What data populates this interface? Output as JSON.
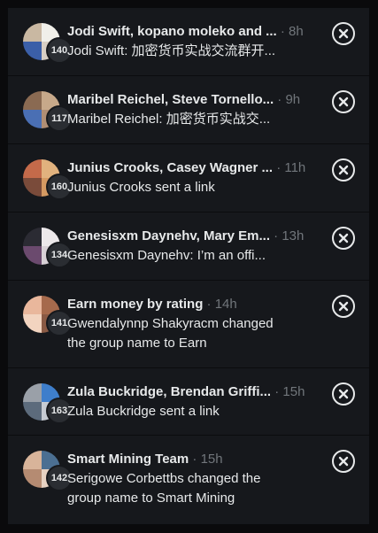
{
  "conversations": [
    {
      "title": "Jodi Swift, kopano moleko and ...",
      "time": "8h",
      "count": "140",
      "preview": "Jodi Swift: 加密货币实战交流群开...",
      "avatar_colors": [
        "#c9b8a2",
        "#f0efe9",
        "#3b5fa8",
        "#d8cfc4"
      ]
    },
    {
      "title": "Maribel Reichel, Steve Tornello...",
      "time": "9h",
      "count": "117",
      "preview": "Maribel Reichel: 加密货币实战交...",
      "avatar_colors": [
        "#8a6a52",
        "#c7a98a",
        "#4a6fb4",
        "#b08e74"
      ]
    },
    {
      "title": "Junius Crooks, Casey Wagner ...",
      "time": "11h",
      "count": "160",
      "preview": "Junius Crooks sent a link",
      "avatar_colors": [
        "#c46a4a",
        "#e1b27e",
        "#7a4b3a",
        "#d59a62"
      ]
    },
    {
      "title": "Genesisxm Daynehv, Mary Em...",
      "time": "13h",
      "count": "134",
      "preview": "Genesisxm Daynehv: I’m an offi...",
      "avatar_colors": [
        "#2b2b33",
        "#ece8ea",
        "#6b4a6e",
        "#d8d1d6"
      ]
    },
    {
      "title": "Earn money by rating",
      "time": "14h",
      "count": "141",
      "preview": "Gwendalynnp Shakyracm changed the group name to Earn",
      "avatar_colors": [
        "#e9b79c",
        "#a66a4c",
        "#f2d4c0",
        "#8a5a44"
      ]
    },
    {
      "title": "Zula Buckridge, Brendan Griffi...",
      "time": "15h",
      "count": "163",
      "preview": "Zula Buckridge sent a link",
      "avatar_colors": [
        "#9aa0a8",
        "#3e7ecb",
        "#5c6b7c",
        "#c6cbd2"
      ]
    },
    {
      "title": "Smart Mining Team",
      "time": "15h",
      "count": "142",
      "preview": "Serigowe Corbettbs changed the group name to Smart Mining",
      "avatar_colors": [
        "#d8b49a",
        "#4b6f92",
        "#b58b72",
        "#e7d2c3"
      ]
    }
  ],
  "close_icon": "close-x-circle-icon"
}
